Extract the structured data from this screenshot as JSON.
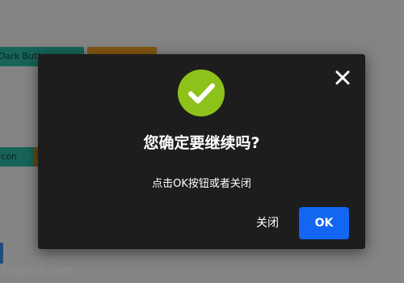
{
  "background": {
    "btn_dark_label": "Dark Button",
    "btn_icon_label": "Icon",
    "watermark": "strapmb.com"
  },
  "modal": {
    "close_icon": "close-icon",
    "success_icon": "check-circle-icon",
    "success_color": "#8cc21a",
    "title": "您确定要继续吗?",
    "message": "点击OK按钮或者关闭",
    "close_label": "关闭",
    "ok_label": "OK",
    "ok_color": "#1266f1"
  }
}
